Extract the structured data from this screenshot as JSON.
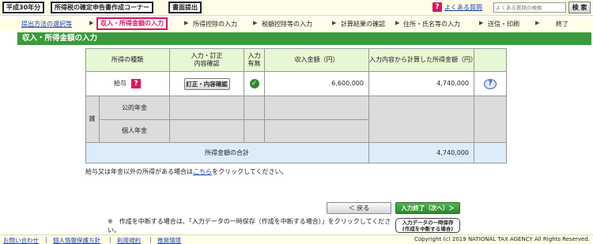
{
  "header": {
    "year_label": "平成30年分",
    "corner_label": "所得税の確定申告書作成コーナー",
    "submit_label": "書面提出",
    "help_icon_char": "?",
    "faq_link": "よくある質問",
    "search_placeholder": "よくある質問の検索",
    "search_button": "検 索"
  },
  "steps": [
    {
      "label": "提出方法の選択等",
      "state": "link"
    },
    {
      "label": "収入・所得金額の入力",
      "state": "current"
    },
    {
      "label": "所得控除の入力",
      "state": "normal"
    },
    {
      "label": "税額控除等の入力",
      "state": "normal"
    },
    {
      "label": "計算結果の確認",
      "state": "normal"
    },
    {
      "label": "住所・氏名等の入力",
      "state": "normal"
    },
    {
      "label": "送信・印刷",
      "state": "normal"
    },
    {
      "label": "終了",
      "state": "normal"
    }
  ],
  "step_arrow": "▶",
  "page_title": "収入・所得金額の入力",
  "table": {
    "headers": {
      "type": "所得の種類",
      "confirm": "入力・訂正\n内容確認",
      "entered": "入力\n有無",
      "income": "収入金額（円）",
      "computed": "入力内容から計算した所得金額（円）"
    },
    "rows": {
      "salary": {
        "label": "給与",
        "confirm_button": "訂正・内容確認",
        "entered": true,
        "income": "6,600,000",
        "computed": "4,740,000"
      },
      "misc_label": "雑",
      "public_pension": {
        "label": "公的年金"
      },
      "private_pension": {
        "label": "個人年金"
      }
    },
    "total_label": "所得金額の合計",
    "total_value": "4,740,000"
  },
  "note": {
    "before": "給与又は年金以外の所得がある場合は",
    "link": "こちら",
    "after": "をクリックしてください。"
  },
  "buttons": {
    "back": "＜ 戻る",
    "next": "入力終了（次へ）＞",
    "save_line1": "入力データの一時保存",
    "save_line2": "(作成を中断する場合)"
  },
  "interrupt_note": "※　作成を中断する場合は、「入力データの一時保存（作成を中断する場合）」をクリックしてください。",
  "footer": {
    "links": [
      "お問い合わせ",
      "個人情報保護方針",
      "利用規約",
      "推奨環境"
    ],
    "separator": "|",
    "copyright": "Copyright (c) 2019 NATIONAL TAX AGENCY All Rights Reserved."
  },
  "colors": {
    "accent_green": "#3b9a3b",
    "accent_pink": "#d8185f",
    "link_blue": "#1a3fb0",
    "header_cell": "#e5f7d3",
    "total_cell": "#dcecf8"
  }
}
